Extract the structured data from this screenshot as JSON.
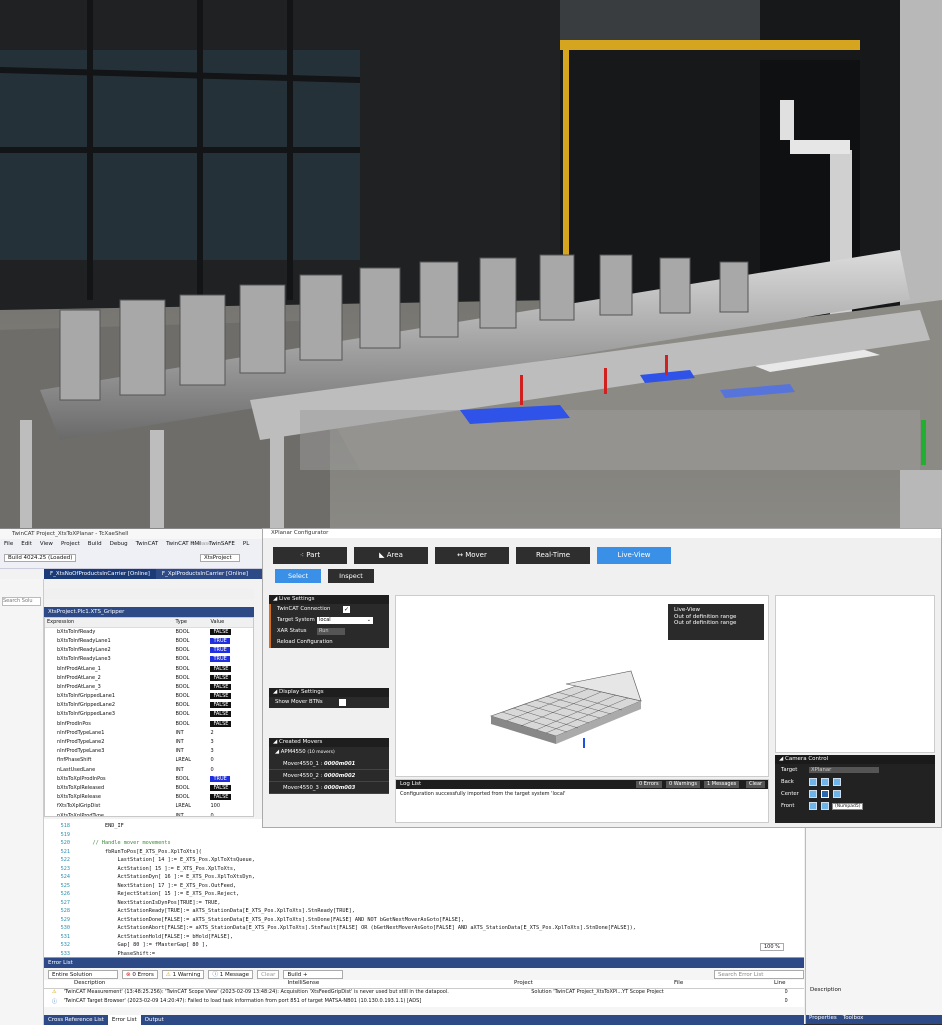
{
  "scene": {
    "description_colors": {
      "floor": "#6b6b68",
      "wall": "#1e2022",
      "window_frame": "#d6a520",
      "conveyor": "#9a9a9a"
    }
  },
  "vs": {
    "title": "TwinCAT Project_XtsToXPlanar - TcXaeShell",
    "menu": [
      "File",
      "Edit",
      "View",
      "Project",
      "Build",
      "Debug",
      "TwinCAT",
      "TwinCAT HMI",
      "TwinSAFE",
      "PL"
    ],
    "build_label": "Build 4024.25 (Loaded)",
    "project_combo": "XtsProject",
    "release": "Release",
    "tabs": [
      "F_XtsNoOfProductsInCarrier [Online]",
      "F_XplProductsInCarrier [Online]"
    ],
    "search_placeholder": "Search Solu",
    "watch_title": "XtsProject.Plc1.XTS_Gripper",
    "watch_cols": [
      "Expression",
      "Type",
      "Value"
    ],
    "watch_rows": [
      {
        "e": "bXtsToInfReady",
        "t": "BOOL",
        "v": "FALSE",
        "k": "f"
      },
      {
        "e": "bXtsToInfReadyLane1",
        "t": "BOOL",
        "v": "TRUE",
        "k": "t"
      },
      {
        "e": "bXtsToInfReadyLane2",
        "t": "BOOL",
        "v": "TRUE",
        "k": "t"
      },
      {
        "e": "bXtsToInfReadyLane3",
        "t": "BOOL",
        "v": "TRUE",
        "k": "t"
      },
      {
        "e": "bInfProdAtLane_1",
        "t": "BOOL",
        "v": "FALSE",
        "k": "f"
      },
      {
        "e": "bInfProdAtLane_2",
        "t": "BOOL",
        "v": "FALSE",
        "k": "f"
      },
      {
        "e": "bInfProdAtLane_3",
        "t": "BOOL",
        "v": "FALSE",
        "k": "f"
      },
      {
        "e": "bXtsToInfGrippedLane1",
        "t": "BOOL",
        "v": "FALSE",
        "k": "f"
      },
      {
        "e": "bXtsToInfGrippedLane2",
        "t": "BOOL",
        "v": "FALSE",
        "k": "f"
      },
      {
        "e": "bXtsToInfGrippedLane3",
        "t": "BOOL",
        "v": "FALSE",
        "k": "f"
      },
      {
        "e": "bInfProdInPos",
        "t": "BOOL",
        "v": "FALSE",
        "k": "f"
      },
      {
        "e": "nInfProdTypeLane1",
        "t": "INT",
        "v": "2",
        "k": ""
      },
      {
        "e": "nInfProdTypeLane2",
        "t": "INT",
        "v": "3",
        "k": ""
      },
      {
        "e": "nInfProdTypeLane3",
        "t": "INT",
        "v": "3",
        "k": ""
      },
      {
        "e": "fInfPhaseShift",
        "t": "LREAL",
        "v": "0",
        "k": ""
      },
      {
        "e": "nLastUsedLane",
        "t": "INT",
        "v": "0",
        "k": ""
      },
      {
        "e": "bXtsToXplProdInPos",
        "t": "BOOL",
        "v": "TRUE",
        "k": "t"
      },
      {
        "e": "bXtsToXplReleased",
        "t": "BOOL",
        "v": "FALSE",
        "k": "f"
      },
      {
        "e": "bXtsToXplRelease",
        "t": "BOOL",
        "v": "FALSE",
        "k": "f"
      },
      {
        "e": "fXtsToXplGripDist",
        "t": "LREAL",
        "v": "100",
        "k": ""
      },
      {
        "e": "nXtsToXplProdType",
        "t": "INT",
        "v": "0",
        "k": ""
      }
    ],
    "code_lines": [
      {
        "n": "518",
        "t": "        END_IF"
      },
      {
        "n": "519",
        "t": ""
      },
      {
        "n": "520",
        "t": "    // Handle mover movements"
      },
      {
        "n": "521",
        "t": "        fbRunToPos[E_XTS_Pos.XplToXts]("
      },
      {
        "n": "522",
        "t": "            LastStation[ 14 ]:= E_XTS_Pos.XplToXtsQueue,"
      },
      {
        "n": "523",
        "t": "            ActStation[ 15 ]:= E_XTS_Pos.XplToXts,"
      },
      {
        "n": "524",
        "t": "            ActStationDyn[ 16 ]:= E_XTS_Pos.XplToXtsDyn,"
      },
      {
        "n": "525",
        "t": "            NextStation[ 17 ]:= E_XTS_Pos.OutFeed,"
      },
      {
        "n": "526",
        "t": "            RejectStation[ 15 ]:= E_XTS_Pos.Reject,"
      },
      {
        "n": "527",
        "t": "            NextStationIsDynPos[TRUE]:= TRUE,"
      },
      {
        "n": "528",
        "t": "            ActStationReady[TRUE]:= aXTS_StationData[E_XTS_Pos.XplToXts].StnReady[TRUE],"
      },
      {
        "n": "529",
        "t": "            ActStationDone[FALSE]:= aXTS_StationData[E_XTS_Pos.XplToXts].StnDone[FALSE] AND NOT bGetNextMoverAsGoto[FALSE],"
      },
      {
        "n": "530",
        "t": "            ActStationAbort[FALSE]:= aXTS_StationData[E_XTS_Pos.XplToXts].StnFault[FALSE] OR (bGetNextMoverAsGoto[FALSE] AND aXTS_StationData[E_XTS_Pos.XplToXts].StnDone[FALSE]),"
      },
      {
        "n": "531",
        "t": "            ActStationHold[FALSE]:= bHold[FALSE],"
      },
      {
        "n": "532",
        "t": "            Gap[ 80 ]:= fMasterGap[ 80 ],"
      },
      {
        "n": "533",
        "t": "            PhaseShift:="
      }
    ],
    "zoom": "100 %",
    "err_title": "Error List",
    "err_scope": "Entire Solution",
    "err_errors": "0 Errors",
    "err_warnings": "1 Warning",
    "err_messages": "1 Message",
    "err_clear": "Clear",
    "err_build": "Build + IntelliSense",
    "err_search": "Search Error List",
    "err_cols": [
      "Description",
      "Project",
      "File",
      "Line"
    ],
    "err_rows": [
      {
        "d": "'TwinCAT Measurement' (13:48:25.256): 'TwinCAT Scope View' (2023-02-09 13:48:24): Acquisition 'XtsFeedGripDist' is never used but still in the datapool.",
        "p": "Solution 'TwinCAT Project_XtsToXPl...YT Scope Project",
        "f": "",
        "l": "0"
      },
      {
        "d": "'TwinCAT Target Browser' (2023-02-09 14:20:47): Failed to load task information from port 851 of target MATSA-NB01 (10.130.0.193.1.1) [ADS]",
        "p": "",
        "f": "",
        "l": "0"
      }
    ],
    "bottom_tabs": [
      "Cross Reference List",
      "Error List",
      "Output"
    ],
    "right_tabs": [
      "Properties",
      "Toolbox"
    ],
    "props_label": "Description"
  },
  "xp": {
    "title": "XPlanar Configurator",
    "tabs": [
      "Part",
      "Area",
      "Mover",
      "Real-Time",
      "Live-View"
    ],
    "subtabs": [
      "Select",
      "Inspect"
    ],
    "live_settings": "Live Settings",
    "twincat_connection": "TwinCAT Connection",
    "target_system_label": "Target System",
    "target_system_value": "local",
    "xar_status_label": "XAR Status",
    "xar_status_value": "Run",
    "reload": "Reload Configuration",
    "display_settings": "Display Settings",
    "show_mover_btns": "Show Mover BTNs",
    "created_movers": "Created Movers",
    "movers_group": "APM4550",
    "movers_count": "(10 movers)",
    "movers": [
      {
        "n": "Mover4550_1",
        "id": "0000m001"
      },
      {
        "n": "Mover4550_2",
        "id": "0000m002"
      },
      {
        "n": "Mover4550_3",
        "id": "0000m003"
      }
    ],
    "liveview_info": [
      "Live-View",
      "Out of definition range",
      "Out of definition range"
    ],
    "log_title": "Log List",
    "log_errors": "0 Errors",
    "log_warnings": "0 Warnings",
    "log_messages": "1 Messages",
    "log_clear": "Clear",
    "log_message": "Configuration successfully imported from the target system 'local'",
    "camera_title": "Camera Control",
    "camera_target_label": "Target",
    "camera_target_value": "XPlanar",
    "camera_back": "Back",
    "camera_center": "Center",
    "camera_front": "Front",
    "tooltip": "(Numpad5)"
  }
}
